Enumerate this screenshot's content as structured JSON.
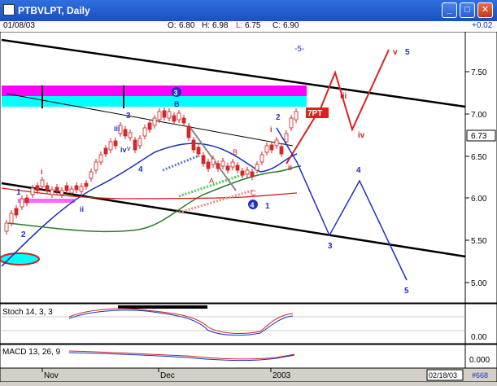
{
  "window": {
    "title": "PTBVLPT, Daily",
    "minimize": "_",
    "maximize": "□",
    "close": "✕"
  },
  "infobar": {
    "date": "01/08/03",
    "open_label": "O:",
    "open": "6.80",
    "high_label": "H:",
    "high": "6.98",
    "low_label": "L:",
    "low": "6.75",
    "close_label": "C:",
    "close": "6.90",
    "change": "+0.02"
  },
  "price_axis": {
    "ticks": [
      "7.50",
      "7.00",
      "6.50",
      "6.00",
      "5.50",
      "5.00"
    ],
    "current": "6.73"
  },
  "wave_labels": {
    "top": "-5-",
    "w3_circle": "3",
    "w3": "3",
    "w3_B": "B",
    "w4_circle": "4",
    "w1": "1",
    "w2": "2",
    "pt_tag": "7PT",
    "iii_top": "iii",
    "iv_top": "iv",
    "v_top": "v",
    "five_top": "5",
    "four_down": "4",
    "three_down": "3",
    "five_down": "5",
    "A": "A",
    "B": "B",
    "C": "C",
    "i_left": "i",
    "ii_left": "ii",
    "one_left": "1",
    "two_left": "2",
    "iii_left": "iii",
    "iv_left": "iv",
    "v_left": "v",
    "four_left": "4",
    "i_right": "i",
    "ii_right": "ii"
  },
  "stoch": {
    "label": "Stoch 14, 3, 3",
    "scale_value": "0.00"
  },
  "macd": {
    "label": "MACD 13, 26, 9",
    "scale_value": "0.000"
  },
  "date_axis": {
    "labels": [
      "Nov",
      "Dec",
      "2003"
    ],
    "end_date": "02/18/03",
    "id_tag": "#668"
  },
  "colors": {
    "candle_up": "#ffffff",
    "candle_down": "#d8282a",
    "ma_blue": "#1a2fb8",
    "ma_green": "#2a7a2a",
    "ma_red": "#d02020",
    "band_magenta": "#ff00ff",
    "band_cyan": "#00ffff",
    "projection_red": "#e02020",
    "projection_blue": "#2030c0"
  }
}
